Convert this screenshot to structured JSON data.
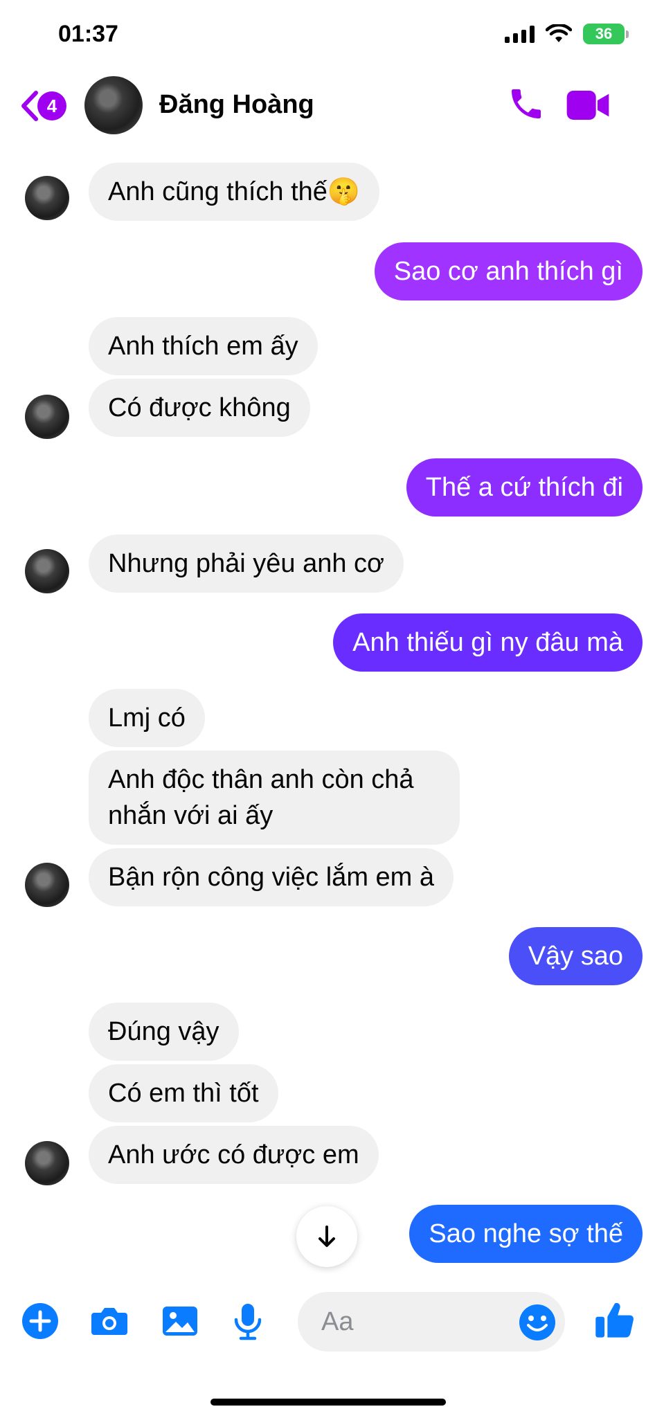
{
  "status_bar": {
    "time": "01:37",
    "battery": "36"
  },
  "header": {
    "back_badge": "4",
    "contact_name": "Đăng Hoàng"
  },
  "colors": {
    "accent": "#a000f0",
    "outgoing_top": "#a033ff",
    "outgoing_mid": "#6a2dff",
    "outgoing_bottom": "#1f6bff",
    "incoming": "#f0f0f0"
  },
  "messages": [
    {
      "dir": "in",
      "text": "Anh cũng thích thế🤫"
    },
    {
      "dir": "out",
      "text": "Sao cơ anh thích gì"
    },
    {
      "dir": "in",
      "text": "Anh thích em ấy"
    },
    {
      "dir": "in",
      "text": "Có được không"
    },
    {
      "dir": "out",
      "text": "Thế a cứ thích đi"
    },
    {
      "dir": "in",
      "text": "Nhưng phải yêu anh cơ"
    },
    {
      "dir": "out",
      "text": "Anh thiếu gì ny đâu mà"
    },
    {
      "dir": "in",
      "text": "Lmj có"
    },
    {
      "dir": "in",
      "text": "Anh độc thân anh còn chả nhắn với ai ấy"
    },
    {
      "dir": "in",
      "text": "Bận rộn công việc lắm em à"
    },
    {
      "dir": "out",
      "text": "Vậy sao"
    },
    {
      "dir": "in",
      "text": "Đúng vậy"
    },
    {
      "dir": "in",
      "text": "Có em thì tốt"
    },
    {
      "dir": "in",
      "text": "Anh ước có được em"
    },
    {
      "dir": "out",
      "text": "Sao nghe sợ thế"
    }
  ],
  "composer": {
    "placeholder": "Aa"
  },
  "icons": {
    "back": "chevron-left-icon",
    "call": "phone-icon",
    "video": "video-camera-icon",
    "scroll": "arrow-down-icon",
    "plus": "plus-icon",
    "camera": "camera-icon",
    "gallery": "image-icon",
    "mic": "microphone-icon",
    "emoji": "smiley-icon",
    "like": "thumbs-up-icon"
  }
}
